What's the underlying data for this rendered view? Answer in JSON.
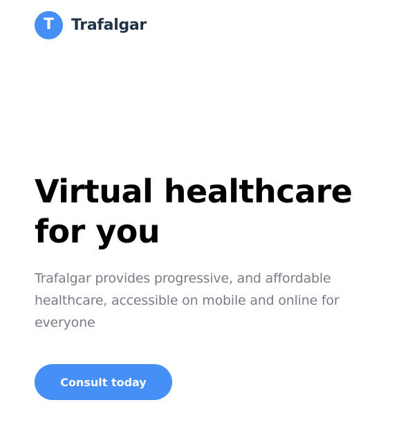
{
  "brand": {
    "logo_letter": "T",
    "name": "Trafalgar",
    "color": "#458ff6"
  },
  "hero": {
    "title_line_1": "Virtual healthcare",
    "title_line_2": "for you",
    "description": "Trafalgar provides progressive, and affordable healthcare, accessible on mobile and online for everyone",
    "cta_label": "Consult today"
  },
  "colors": {
    "accent": "#458ff6",
    "title": "#000000",
    "brand_text": "#233348",
    "body_text": "#7d7987",
    "background": "#ffffff"
  }
}
